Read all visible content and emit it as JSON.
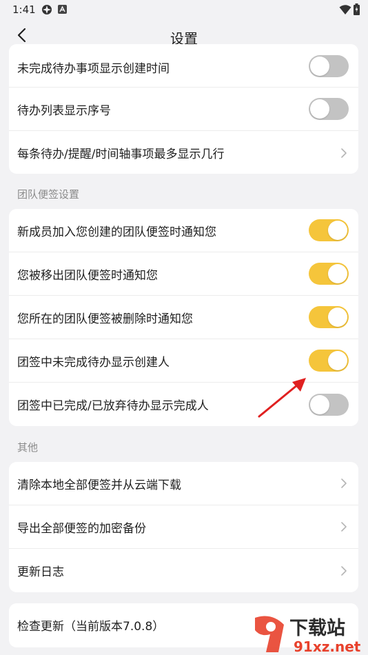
{
  "status_bar": {
    "time": "1:41"
  },
  "header": {
    "title": "设置"
  },
  "section1": {
    "items": [
      {
        "label": "未完成待办事项显示创建时间",
        "control": "toggle",
        "on": false
      },
      {
        "label": "待办列表显示序号",
        "control": "toggle",
        "on": false
      },
      {
        "label": "每条待办/提醒/时间轴事项最多显示几行",
        "control": "chevron"
      }
    ]
  },
  "section2": {
    "title": "团队便签设置",
    "items": [
      {
        "label": "新成员加入您创建的团队便签时通知您",
        "control": "toggle",
        "on": true
      },
      {
        "label": "您被移出团队便签时通知您",
        "control": "toggle",
        "on": true
      },
      {
        "label": "您所在的团队便签被删除时通知您",
        "control": "toggle",
        "on": true
      },
      {
        "label": "团签中未完成待办显示创建人",
        "control": "toggle",
        "on": true
      },
      {
        "label": "团签中已完成/已放弃待办显示完成人",
        "control": "toggle",
        "on": false
      }
    ]
  },
  "section3": {
    "title": "其他",
    "items": [
      {
        "label": "清除本地全部便签并从云端下载",
        "control": "chevron"
      },
      {
        "label": "导出全部便签的加密备份",
        "control": "chevron"
      },
      {
        "label": "更新日志",
        "control": "chevron"
      }
    ]
  },
  "section4": {
    "items": [
      {
        "label": "检查更新（当前版本7.0.8）"
      }
    ]
  },
  "watermark": {
    "brand": "下载站",
    "site": "91xz.net"
  },
  "colors": {
    "toggle_on": "#f5c53b",
    "toggle_off": "#c3c3c3",
    "annotation_arrow": "#e02020"
  }
}
